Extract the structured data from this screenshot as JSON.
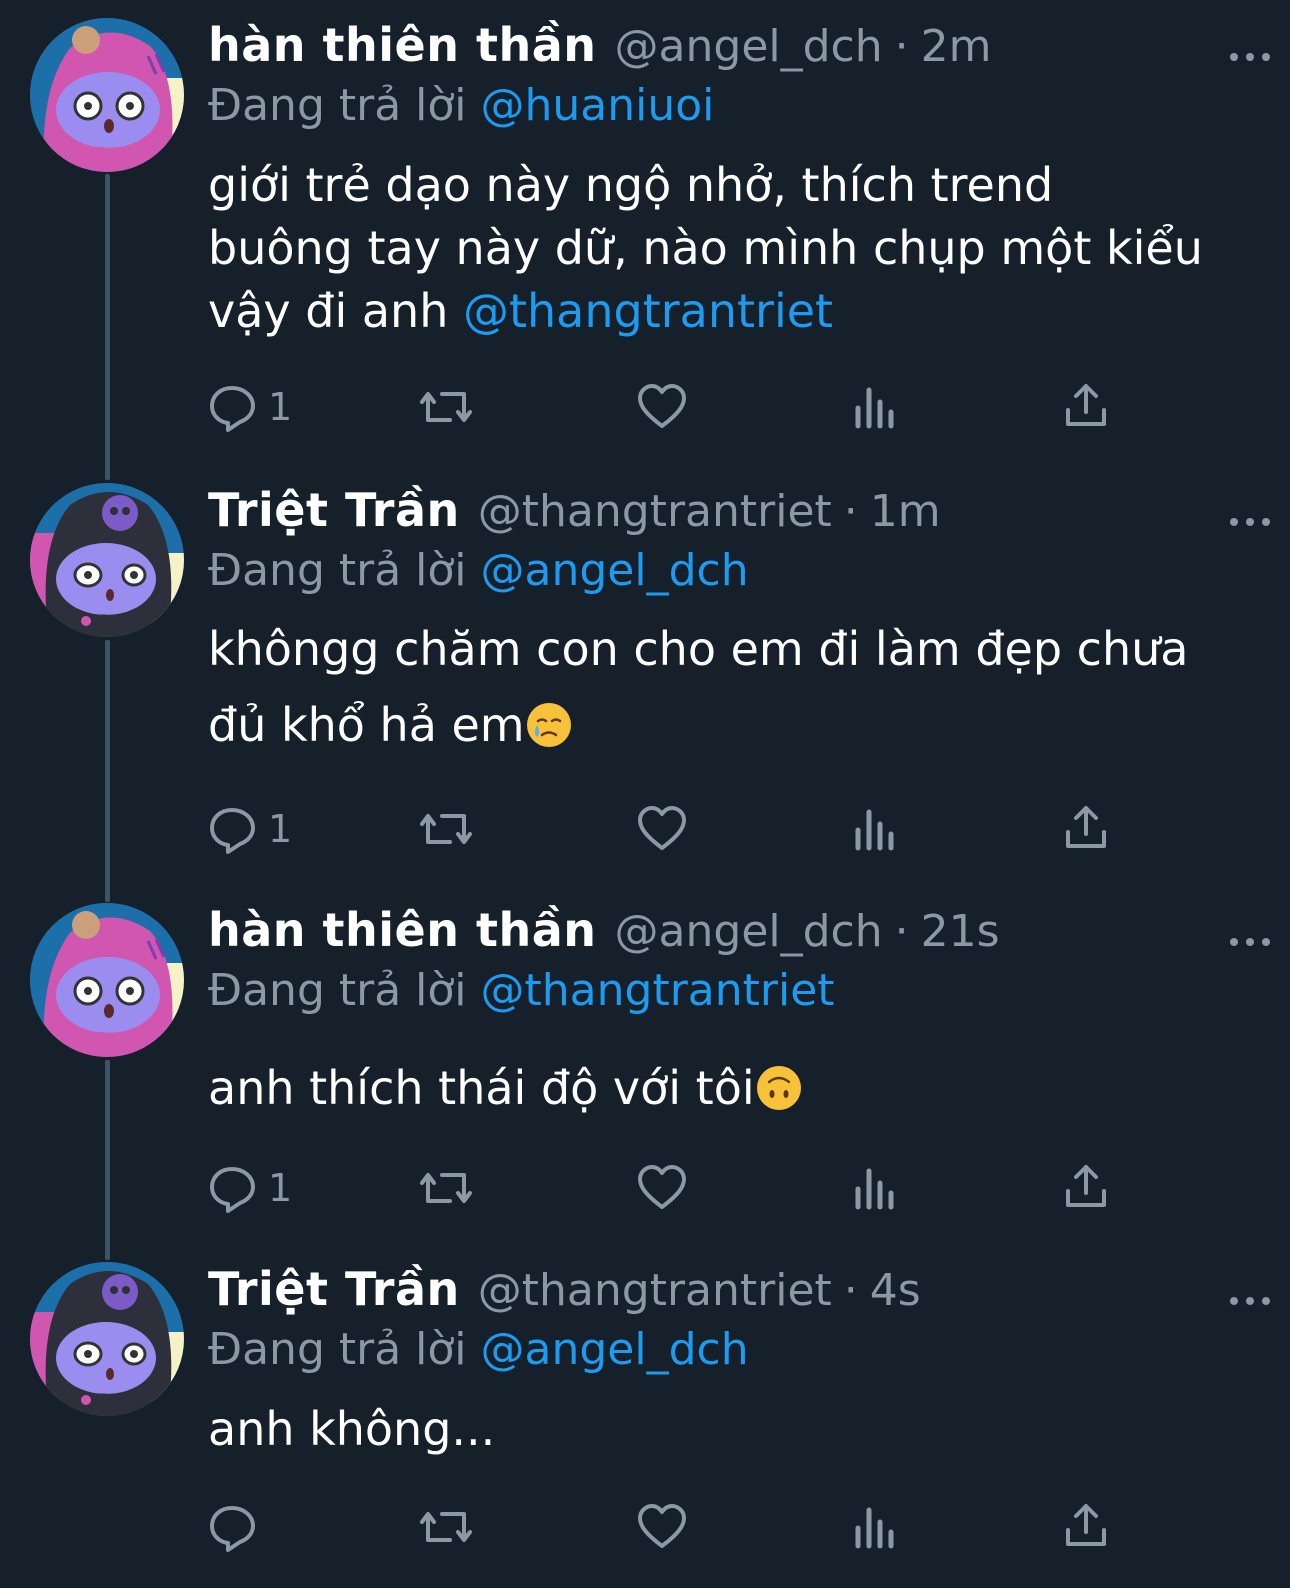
{
  "thread": [
    {
      "name": "hàn thiên thần",
      "handle": "@angel_dch",
      "separator": "·",
      "time": "2m",
      "reply_prefix": "Đang trả lời",
      "reply_to": "@huaniuoi",
      "lines": [
        "giới trẻ dạo này ngộ nhở, thích trend",
        "buông tay này dữ, nào mình chụp một kiểu"
      ],
      "line3_text": "vậy đi anh ",
      "line3_mention": "@thangtrantriet",
      "reply_count": "1",
      "avatar": "pink-hood-character"
    },
    {
      "name": "Triệt Trần",
      "handle": "@thangtrantriet",
      "separator": "·",
      "time": "1m",
      "reply_prefix": "Đang trả lời",
      "reply_to": "@angel_dch",
      "line1": "khôngg chăm con cho em đi làm đẹp chưa",
      "line2": "đủ khổ hả em",
      "emoji": "crying-face",
      "reply_count": "1",
      "avatar": "dark-hood-skull-character"
    },
    {
      "name": "hàn thiên thần",
      "handle": "@angel_dch",
      "separator": "·",
      "time": "21s",
      "reply_prefix": "Đang trả lời",
      "reply_to": "@thangtrantriet",
      "line1": "anh thích thái độ với tôi",
      "emoji": "upside-down-face",
      "reply_count": "1",
      "avatar": "pink-hood-character"
    },
    {
      "name": "Triệt Trần",
      "handle": "@thangtrantriet",
      "separator": "·",
      "time": "4s",
      "reply_prefix": "Đang trả lời",
      "reply_to": "@angel_dch",
      "line1": "anh không...",
      "reply_count": "",
      "avatar": "dark-hood-skull-character"
    }
  ],
  "icons": [
    "reply-icon",
    "retweet-icon",
    "like-icon",
    "analytics-icon",
    "share-icon",
    "more-icon"
  ],
  "colors": {
    "background": "#15202b",
    "muted": "#8b98a5",
    "accent": "#1d9bf0",
    "thread_line": "#3d5466"
  }
}
